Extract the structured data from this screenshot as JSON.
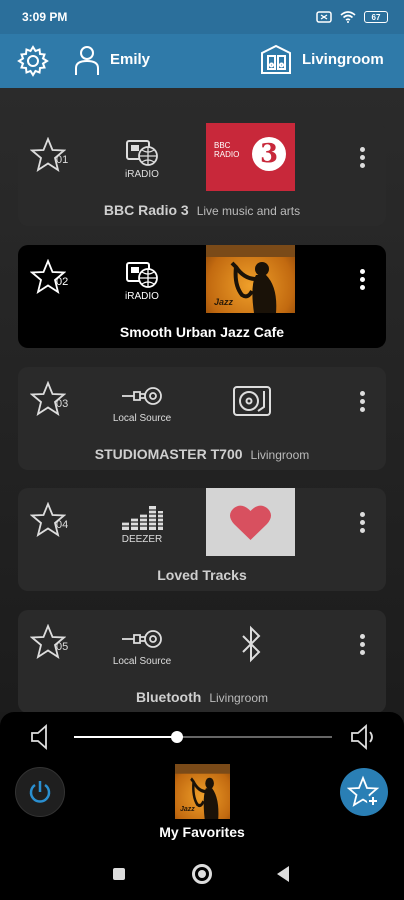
{
  "status": {
    "time": "3:09 PM",
    "battery": "67"
  },
  "header": {
    "user_name": "Emily",
    "room_name": "Livingroom"
  },
  "favorites": [
    {
      "number": "01",
      "source_label": "iRADIO",
      "title": "BBC Radio 3",
      "subtitle": "Live music and arts",
      "art_text": "BBC RADIO",
      "art_numeral": "3"
    },
    {
      "number": "02",
      "source_label": "iRADIO",
      "title": "Smooth Urban Jazz Cafe",
      "subtitle": "",
      "art_text": "Jazz"
    },
    {
      "number": "03",
      "source_label": "Local Source",
      "title": "STUDIOMASTER T700",
      "subtitle": "Livingroom"
    },
    {
      "number": "04",
      "source_label": "DEEZER",
      "title": "Loved Tracks",
      "subtitle": ""
    },
    {
      "number": "05",
      "source_label": "Local Source",
      "title": "Bluetooth",
      "subtitle": "Livingroom"
    }
  ],
  "player": {
    "volume": 0.4,
    "now_playing_title": "My Favorites",
    "art_text": "Jazz"
  },
  "colors": {
    "header": "#2f7aa9",
    "status_bar": "#2b6f9b",
    "accent": "#2a7fb5",
    "bbc_red": "#c8283a",
    "heart": "#d8505f"
  }
}
